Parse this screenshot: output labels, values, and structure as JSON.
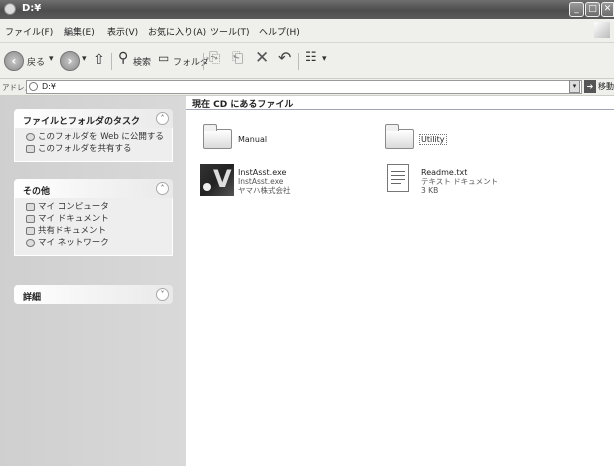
{
  "window": {
    "title": "D:¥"
  },
  "menu": [
    "ファイル(F)",
    "編集(E)",
    "表示(V)",
    "お気に入り(A)",
    "ツール(T)",
    "ヘルプ(H)"
  ],
  "toolbar": {
    "back_label": "戻る",
    "search_label": "検索",
    "folders_label": "フォルダ"
  },
  "address": {
    "label": "アドレス(D)",
    "value": "D:¥",
    "go_label": "移動"
  },
  "tasks_panel": {
    "title": "ファイルとフォルダのタスク",
    "items": [
      "このフォルダを Web に公開する",
      "このフォルダを共有する"
    ]
  },
  "other_panel": {
    "title": "その他",
    "items": [
      "マイ コンピュータ",
      "マイ ドキュメント",
      "共有ドキュメント",
      "マイ ネットワーク"
    ]
  },
  "details_panel": {
    "title": "詳細"
  },
  "content": {
    "group_title": "現在 CD にあるファイル",
    "items": [
      {
        "name": "Manual",
        "type": "folder"
      },
      {
        "name": "Utility",
        "type": "folder"
      },
      {
        "name": "InstAsst.exe",
        "line2": "InstAsst.exe",
        "line3": "ヤマハ株式会社",
        "type": "exe"
      },
      {
        "name": "Readme.txt",
        "line2": "テキスト ドキュメント",
        "line3": "3 KB",
        "type": "text"
      }
    ]
  }
}
